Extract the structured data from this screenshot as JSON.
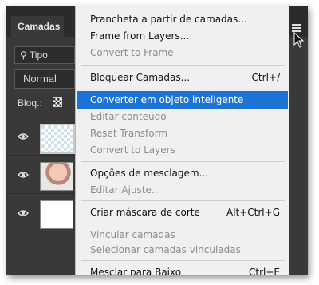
{
  "panel": {
    "tab_label": "Camadas",
    "search_value": "Tipo",
    "blend_mode": "Normal",
    "lock_label": "Bloq.:"
  },
  "layers": [
    {
      "thumbnail": "transparent",
      "visible": true
    },
    {
      "thumbnail": "photo-girl",
      "visible": true
    },
    {
      "thumbnail": "white",
      "visible": true
    }
  ],
  "menu": {
    "items": [
      {
        "label": "Prancheta a partir de camadas...",
        "shortcut": "",
        "enabled": true
      },
      {
        "label": "Frame from Layers...",
        "shortcut": "",
        "enabled": true
      },
      {
        "label": "Convert to Frame",
        "shortcut": "",
        "enabled": false
      },
      {
        "label": "Bloquear Camadas...",
        "shortcut": "Ctrl+/",
        "enabled": true
      },
      {
        "label": "Converter em objeto inteligente",
        "shortcut": "",
        "enabled": true,
        "highlighted": true
      },
      {
        "label": "Editar conteúdo",
        "shortcut": "",
        "enabled": false
      },
      {
        "label": "Reset Transform",
        "shortcut": "",
        "enabled": false
      },
      {
        "label": "Convert to Layers",
        "shortcut": "",
        "enabled": false
      },
      {
        "label": "Opções de mesclagem...",
        "shortcut": "",
        "enabled": true
      },
      {
        "label": "Editar Ajuste...",
        "shortcut": "",
        "enabled": false
      },
      {
        "label": "Criar máscara de corte",
        "shortcut": "Alt+Ctrl+G",
        "enabled": true
      },
      {
        "label": "Vincular camadas",
        "shortcut": "",
        "enabled": false
      },
      {
        "label": "Selecionar camadas vinculadas",
        "shortcut": "",
        "enabled": false
      },
      {
        "label": "Mesclar para Baixo",
        "shortcut": "Ctrl+E",
        "enabled": true
      }
    ]
  },
  "colors": {
    "highlight": "#1c73d6",
    "panel_bg": "#393939",
    "menu_bg": "#f0f0f0"
  }
}
